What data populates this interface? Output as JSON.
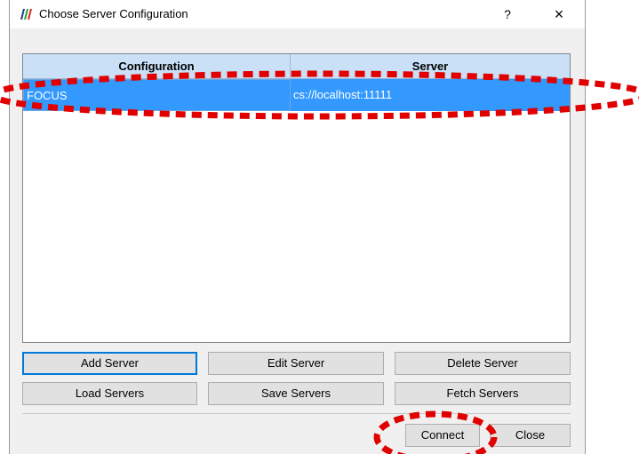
{
  "window": {
    "title": "Choose Server Configuration",
    "help_label": "?",
    "close_label": "×"
  },
  "table": {
    "columns": [
      "Configuration",
      "Server"
    ],
    "rows": [
      {
        "configuration": "FOCUS",
        "server": "cs://localhost:11111",
        "selected": true
      }
    ]
  },
  "buttons": {
    "add_server": "Add Server",
    "edit_server": "Edit Server",
    "delete_server": "Delete Server",
    "load_servers": "Load Servers",
    "save_servers": "Save Servers",
    "fetch_servers": "Fetch Servers",
    "connect": "Connect",
    "close": "Close"
  },
  "colors": {
    "selection": "#3399ff",
    "header": "#c9e0f7",
    "annotation": "#e00000",
    "focus_border": "#0078d7"
  },
  "icons": {
    "app": "paraview-logo-icon"
  }
}
